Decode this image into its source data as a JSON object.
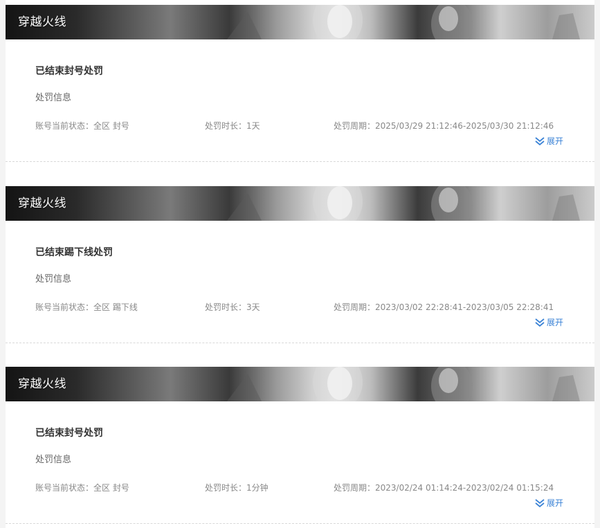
{
  "records": [
    {
      "game_name": "穿越火线",
      "punish_title": "已结束封号处罚",
      "info_label": "处罚信息",
      "status_label": "账号当前状态：",
      "status_value": "全区 封号",
      "duration_label": "处罚时长：",
      "duration_value": "1天",
      "period_label": "处罚周期：",
      "period_value": "2025/03/29 21:12:46-2025/03/30 21:12:46",
      "expand_label": "展开"
    },
    {
      "game_name": "穿越火线",
      "punish_title": "已结束踢下线处罚",
      "info_label": "处罚信息",
      "status_label": "账号当前状态：",
      "status_value": "全区 踢下线",
      "duration_label": "处罚时长：",
      "duration_value": "3天",
      "period_label": "处罚周期：",
      "period_value": "2023/03/02 22:28:41-2023/03/05 22:28:41",
      "expand_label": "展开"
    },
    {
      "game_name": "穿越火线",
      "punish_title": "已结束封号处罚",
      "info_label": "处罚信息",
      "status_label": "账号当前状态：",
      "status_value": "全区 封号",
      "duration_label": "处罚时长：",
      "duration_value": "1分钟",
      "period_label": "处罚周期：",
      "period_value": "2023/02/24 01:14:24-2023/02/24 01:15:24",
      "expand_label": "展开"
    }
  ],
  "colors": {
    "accent": "#3b83d6",
    "title_text": "#333333",
    "meta_text": "#888888",
    "banner_dark": "#141414"
  },
  "icons": {
    "expand": "double-chevron-down-icon"
  }
}
